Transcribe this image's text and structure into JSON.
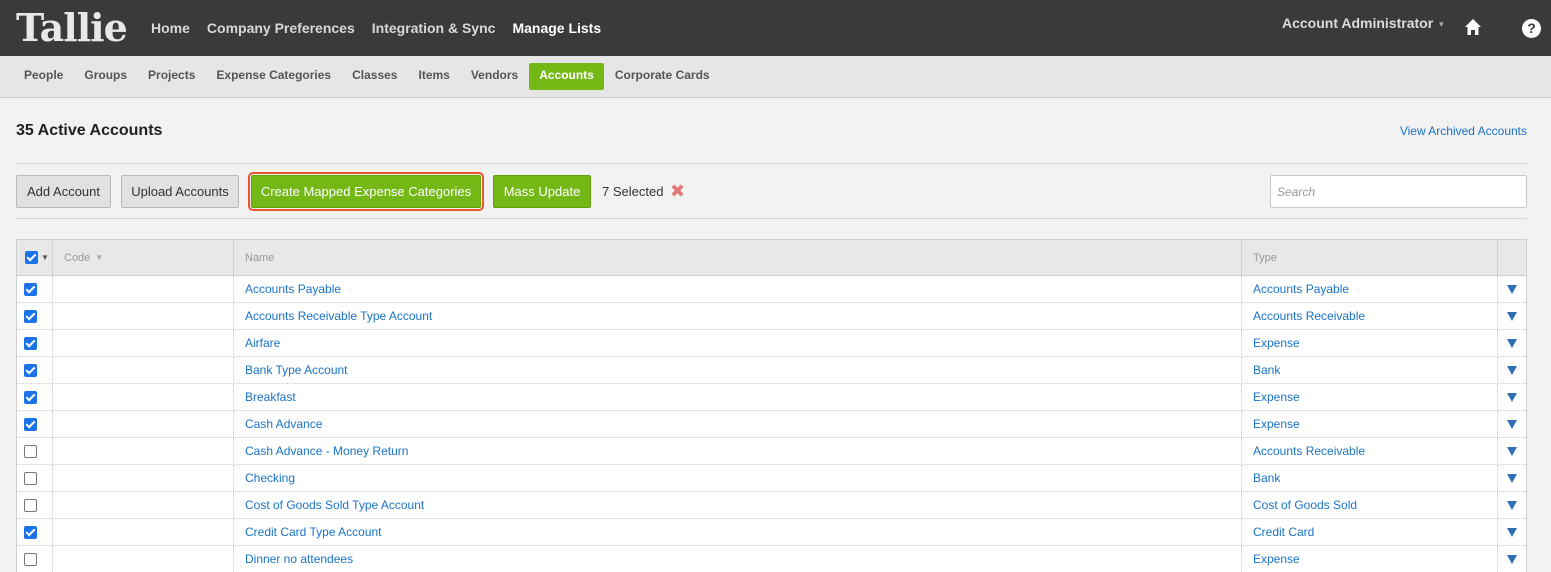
{
  "app": {
    "logo": "Tallie"
  },
  "topnav": [
    {
      "label": "Home",
      "active": false
    },
    {
      "label": "Company Preferences",
      "active": false
    },
    {
      "label": "Integration & Sync",
      "active": false
    },
    {
      "label": "Manage Lists",
      "active": true
    }
  ],
  "account": {
    "label": "Account Administrator",
    "caret": "▾"
  },
  "icons": {
    "home": "home-icon",
    "help": "?"
  },
  "subnav": [
    {
      "label": "People",
      "active": false
    },
    {
      "label": "Groups",
      "active": false
    },
    {
      "label": "Projects",
      "active": false
    },
    {
      "label": "Expense Categories",
      "active": false
    },
    {
      "label": "Classes",
      "active": false
    },
    {
      "label": "Items",
      "active": false
    },
    {
      "label": "Vendors",
      "active": false
    },
    {
      "label": "Accounts",
      "active": true
    },
    {
      "label": "Corporate Cards",
      "active": false
    }
  ],
  "page": {
    "title": "35 Active Accounts",
    "archived_link": "View Archived Accounts"
  },
  "toolbar": {
    "add_account": "Add Account",
    "upload_accounts": "Upload Accounts",
    "create_mapped": "Create Mapped Expense Categories",
    "mass_update": "Mass Update",
    "selected_count": "7 Selected",
    "clear_symbol": "✖",
    "search_placeholder": "Search"
  },
  "table": {
    "header_select_all": true,
    "columns": [
      "Code",
      "Name",
      "Type"
    ],
    "rows": [
      {
        "checked": true,
        "code": "",
        "name": "Accounts Payable",
        "type": "Accounts Payable"
      },
      {
        "checked": true,
        "code": "",
        "name": "Accounts Receivable Type Account",
        "type": "Accounts Receivable"
      },
      {
        "checked": true,
        "code": "",
        "name": "Airfare",
        "type": "Expense"
      },
      {
        "checked": true,
        "code": "",
        "name": "Bank Type Account",
        "type": "Bank"
      },
      {
        "checked": true,
        "code": "",
        "name": "Breakfast",
        "type": "Expense"
      },
      {
        "checked": true,
        "code": "",
        "name": "Cash Advance",
        "type": "Expense"
      },
      {
        "checked": false,
        "code": "",
        "name": "Cash Advance - Money Return",
        "type": "Accounts Receivable"
      },
      {
        "checked": false,
        "code": "",
        "name": "Checking",
        "type": "Bank"
      },
      {
        "checked": false,
        "code": "",
        "name": "Cost of Goods Sold Type Account",
        "type": "Cost of Goods Sold"
      },
      {
        "checked": true,
        "code": "",
        "name": "Credit Card Type Account",
        "type": "Credit Card"
      },
      {
        "checked": false,
        "code": "",
        "name": "Dinner no attendees",
        "type": "Expense"
      }
    ]
  },
  "colors": {
    "topbar": "#3a3a3a",
    "accent_green": "#74b816",
    "link_blue": "#1a73c7",
    "highlight_outline": "#e8562a",
    "checkbox_blue": "#1a73e8"
  }
}
